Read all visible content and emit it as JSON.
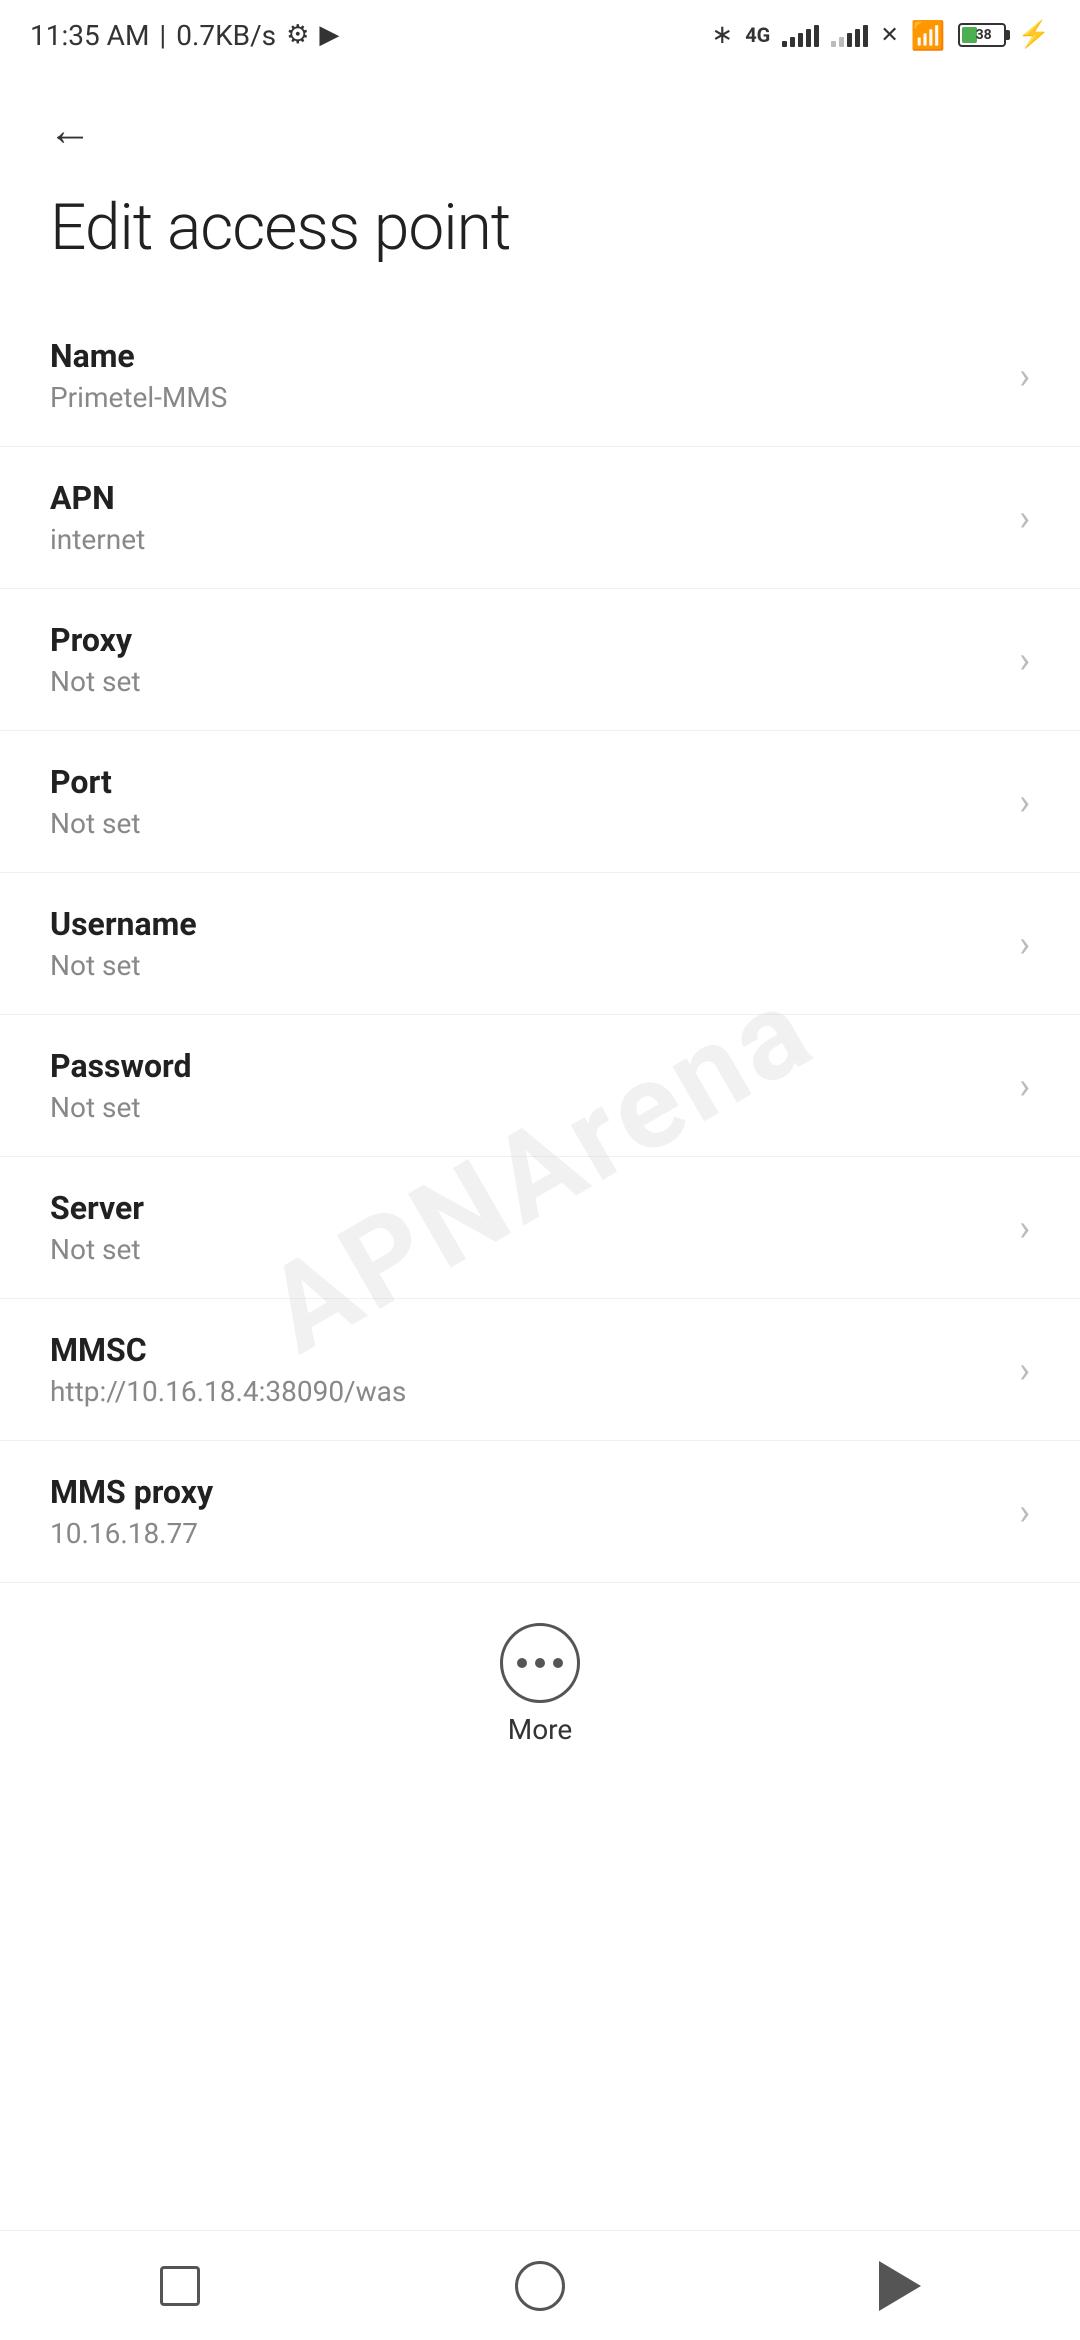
{
  "statusBar": {
    "time": "11:35 AM",
    "dataSpeed": "0.7KB/s"
  },
  "header": {
    "backLabel": "←",
    "title": "Edit access point"
  },
  "items": [
    {
      "label": "Name",
      "value": "Primetel-MMS"
    },
    {
      "label": "APN",
      "value": "internet"
    },
    {
      "label": "Proxy",
      "value": "Not set"
    },
    {
      "label": "Port",
      "value": "Not set"
    },
    {
      "label": "Username",
      "value": "Not set"
    },
    {
      "label": "Password",
      "value": "Not set"
    },
    {
      "label": "Server",
      "value": "Not set"
    },
    {
      "label": "MMSC",
      "value": "http://10.16.18.4:38090/was"
    },
    {
      "label": "MMS proxy",
      "value": "10.16.18.77"
    }
  ],
  "more": {
    "label": "More"
  },
  "watermark": "APNArena",
  "nav": {
    "square": "",
    "circle": "",
    "back": ""
  }
}
